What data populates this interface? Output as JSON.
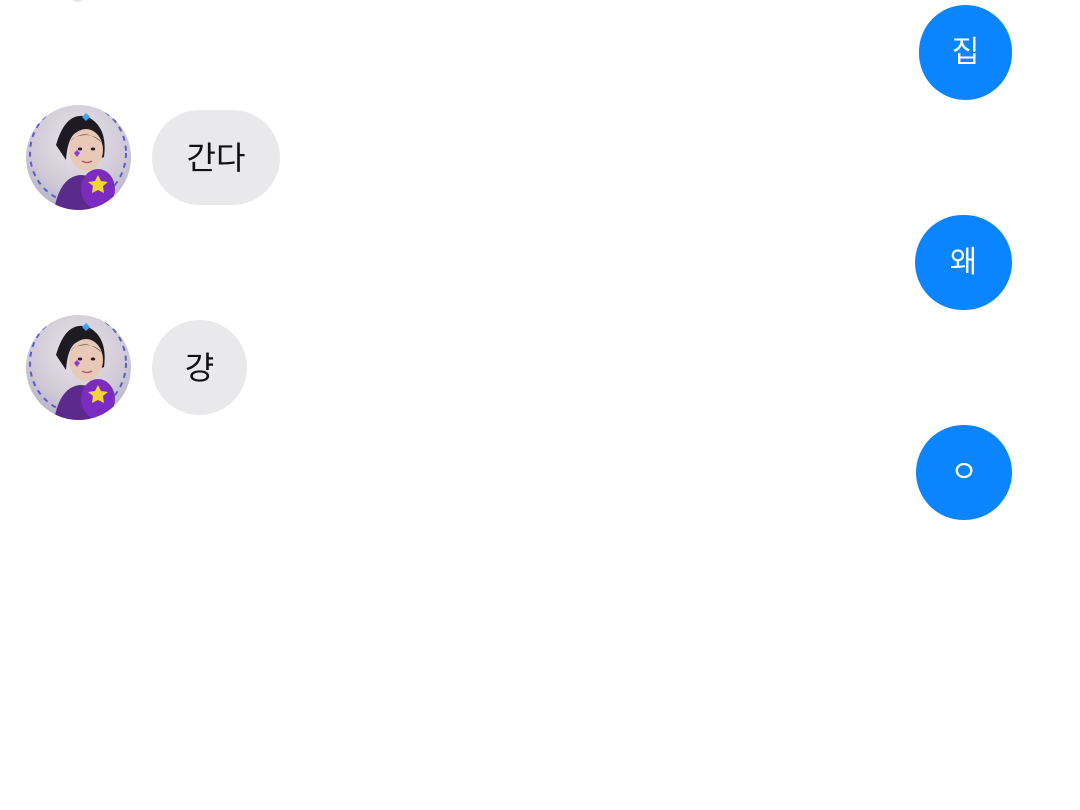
{
  "messages": [
    {
      "direction": "outgoing",
      "text": "집"
    },
    {
      "direction": "incoming",
      "text": "간다"
    },
    {
      "direction": "outgoing",
      "text": "왜"
    },
    {
      "direction": "incoming",
      "text": "걍"
    },
    {
      "direction": "outgoing",
      "text": "ㅇ"
    }
  ],
  "colors": {
    "outgoing_bubble": "#0a84ff",
    "incoming_bubble": "#e9e9eb",
    "outgoing_text": "#ffffff",
    "incoming_text": "#111111"
  }
}
